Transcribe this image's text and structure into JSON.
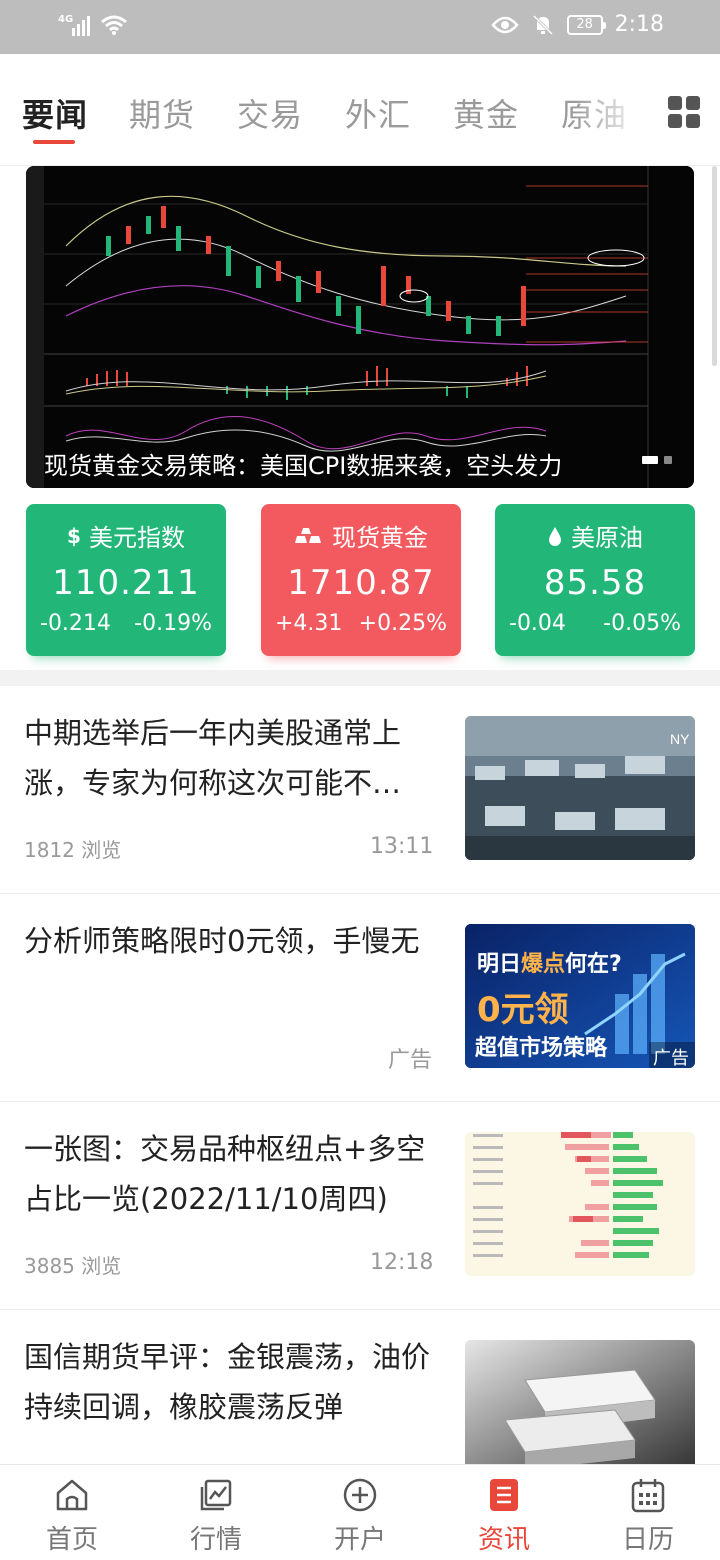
{
  "status_bar": {
    "network": "4G",
    "time": "2:18",
    "battery": "28"
  },
  "tabs": [
    {
      "label": "要闻",
      "active": true
    },
    {
      "label": "期货",
      "active": false
    },
    {
      "label": "交易",
      "active": false
    },
    {
      "label": "外汇",
      "active": false
    },
    {
      "label": "黄金",
      "active": false
    },
    {
      "label": "原油",
      "active": false
    }
  ],
  "banner": {
    "caption": "现货黄金交易策略：美国CPI数据来袭，空头发力",
    "page_count": 2,
    "active_index": 0
  },
  "quotes": [
    {
      "name": "美元指数",
      "icon": "dollar-icon",
      "value": "110.211",
      "change": "-0.214",
      "change_pct": "-0.19%",
      "color": "#22b779"
    },
    {
      "name": "现货黄金",
      "icon": "gold-bars-icon",
      "value": "1710.87",
      "change": "+4.31",
      "change_pct": "+0.25%",
      "color": "#f35a5f"
    },
    {
      "name": "美原油",
      "icon": "oil-drop-icon",
      "value": "85.58",
      "change": "-0.04",
      "change_pct": "-0.05%",
      "color": "#22b779"
    }
  ],
  "news": [
    {
      "title": "中期选举后一年内美股通常上涨，专家为何称这次可能不…",
      "views": "1812 浏览",
      "time": "13:11"
    },
    {
      "title": "分析师策略限时0元领，手慢无",
      "ad_label": "广告",
      "thumb_text": {
        "line1_a": "明日",
        "line1_b": "爆点",
        "line1_c": "何在?",
        "line2": "0元领",
        "line3": "超值市场策略",
        "badge": "广告"
      }
    },
    {
      "title": "一张图：交易品种枢纽点+多空占比一览(2022/11/10周四)",
      "views": "3885 浏览",
      "time": "12:18"
    },
    {
      "title": "国信期货早评：金银震荡，油价持续回调，橡胶震荡反弹"
    }
  ],
  "bottom_nav": [
    {
      "label": "首页",
      "icon": "home-icon",
      "active": false
    },
    {
      "label": "行情",
      "icon": "market-chart-icon",
      "active": false
    },
    {
      "label": "开户",
      "icon": "add-circle-icon",
      "active": false
    },
    {
      "label": "资讯",
      "icon": "news-icon",
      "active": true
    },
    {
      "label": "日历",
      "icon": "calendar-icon",
      "active": false
    }
  ],
  "colors": {
    "accent": "#e8473a",
    "up": "#f35a5f",
    "down": "#22b779"
  }
}
